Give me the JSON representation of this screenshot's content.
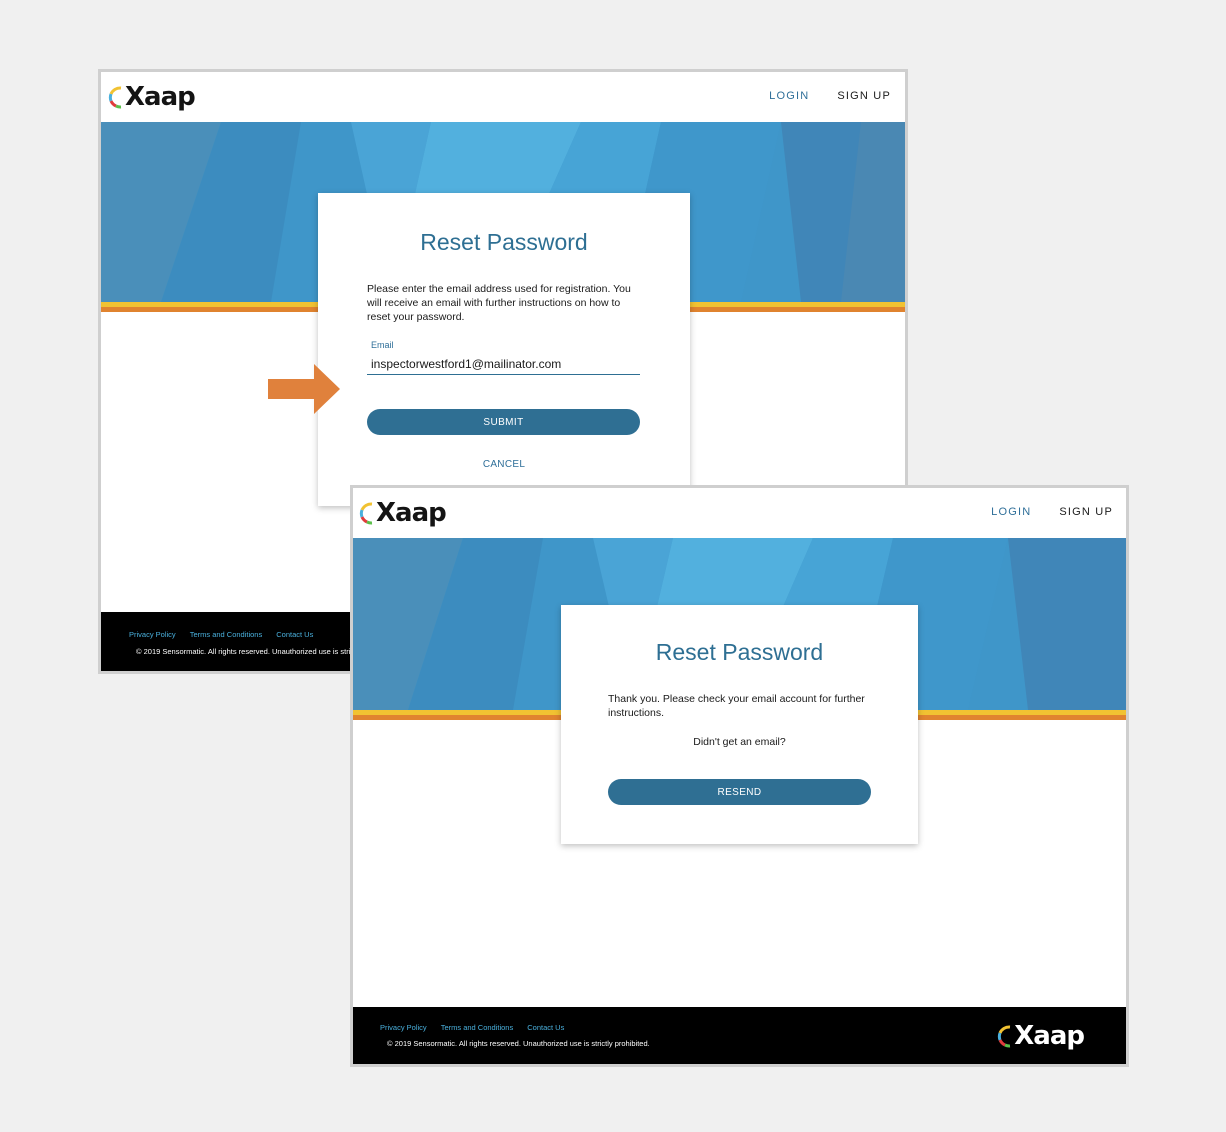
{
  "brand": {
    "name": "Xaap"
  },
  "nav": {
    "login": "LOGIN",
    "signup": "SIGN UP"
  },
  "screen1": {
    "title": "Reset Password",
    "instructions": "Please enter the email address used for registration. You will receive an email with further instructions on how to reset your password.",
    "email_label": "Email",
    "email_value": "inspectorwestford1@mailinator.com",
    "submit_label": "SUBMIT",
    "cancel_label": "CANCEL"
  },
  "screen2": {
    "title": "Reset Password",
    "message": "Thank you. Please check your email account for further instructions.",
    "no_email": "Didn't get an email?",
    "resend_label": "RESEND"
  },
  "footer": {
    "links": [
      "Privacy Policy",
      "Terms and Conditions",
      "Contact Us"
    ],
    "copyright": "© 2019 Sensormatic. All rights reserved. Unauthorized use is strictly prohibited."
  },
  "colors": {
    "accent": "#2f6f93",
    "hero_blue": "#3f96c9",
    "stripe_yellow": "#f1c232",
    "stripe_orange": "#e0832f",
    "arrow_orange": "#e0813c"
  }
}
